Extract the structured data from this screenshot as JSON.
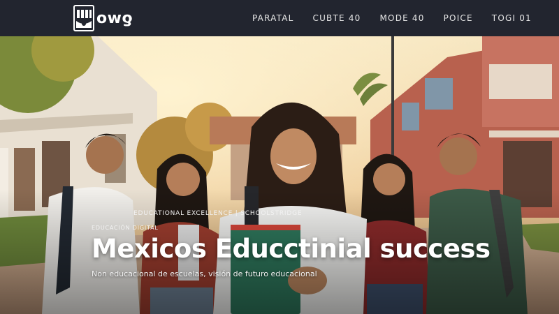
{
  "brand": {
    "name": "owƍ",
    "logo_icon": "seal-icon"
  },
  "nav": {
    "items": [
      {
        "label": "PARATAL"
      },
      {
        "label": "CUBTE 40"
      },
      {
        "label": "MODE 40"
      },
      {
        "label": "POICE"
      },
      {
        "label": "TOGI 01"
      }
    ]
  },
  "hero": {
    "eyebrow": "EDUCATIONAL EXCELLENCE | SCHOOLSTRIDGE",
    "tagline": "EDUCACIÓN DIGITAL",
    "headline": "Mexicos Educctinial success",
    "subhead": "Non educacional de escuelas, visión de futuro educacional"
  },
  "colors": {
    "nav_bg": "#22252f",
    "text": "#ffffff",
    "sky": "#f3d9a6",
    "brick": "#b8614e"
  }
}
